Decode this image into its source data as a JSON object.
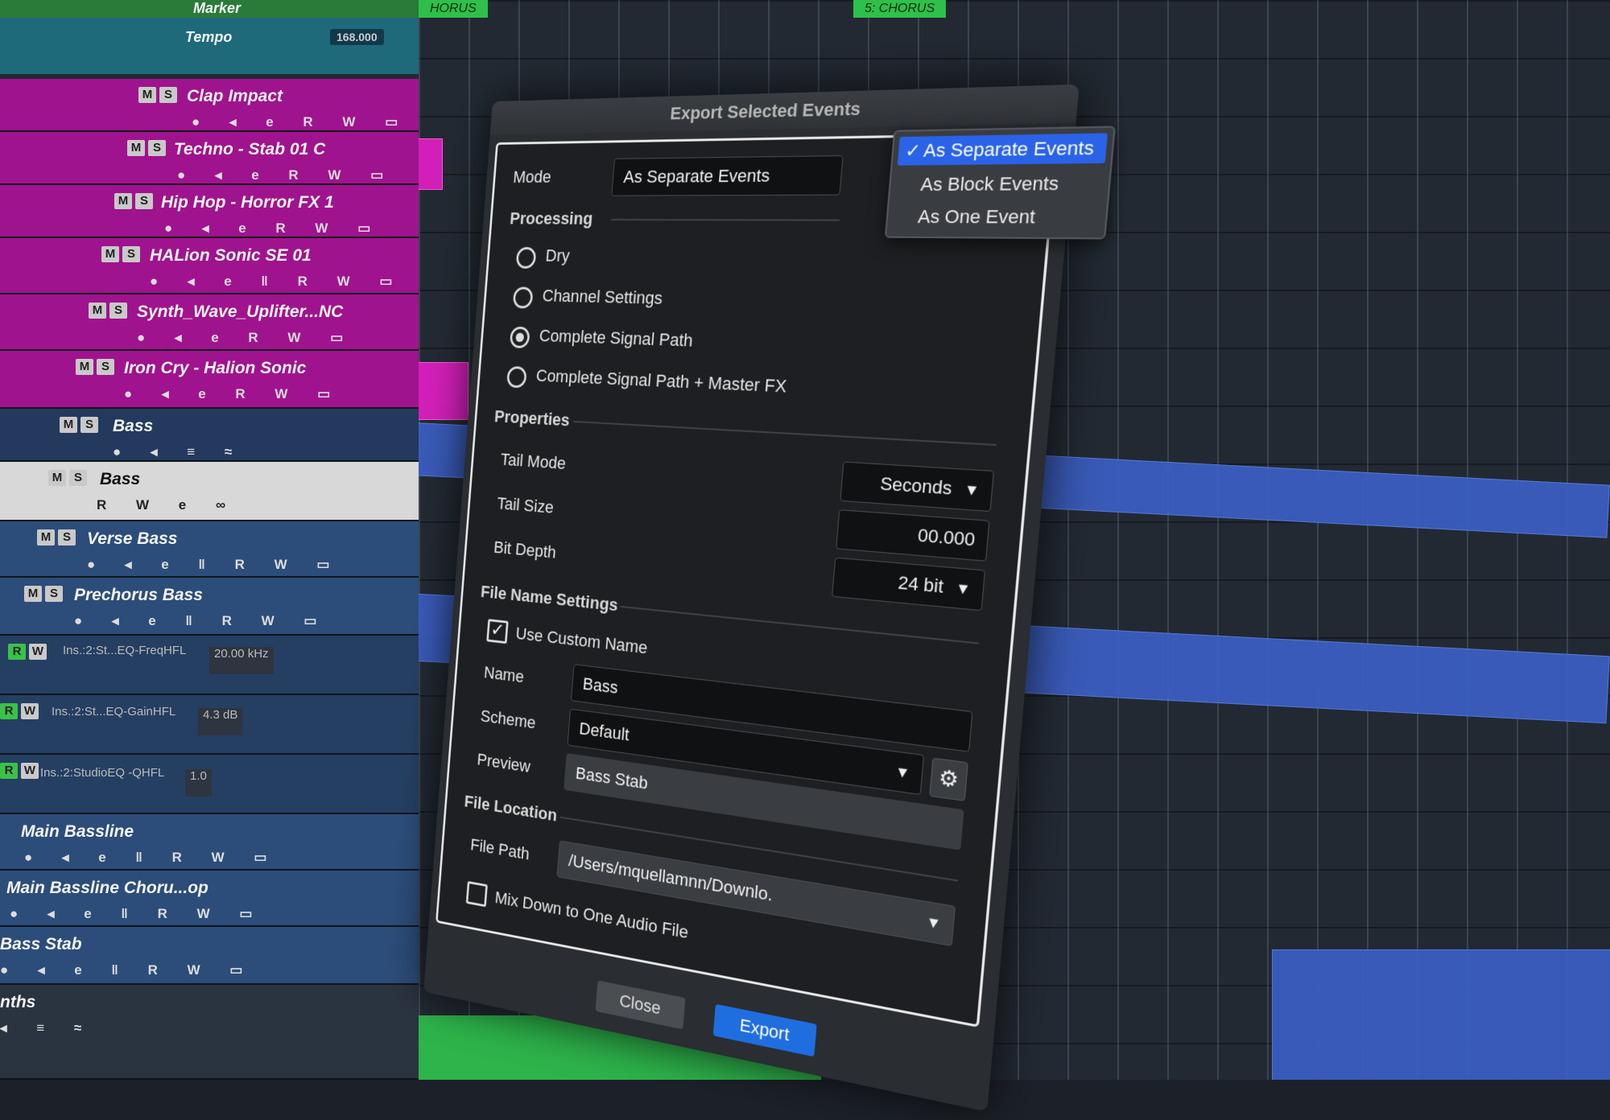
{
  "markers": {
    "marker_label": "Marker",
    "tempo_label": "Tempo",
    "tempo_value": "168.000",
    "chorus_left": "HORUS",
    "chorus_marker": "5: CHORUS"
  },
  "tracks": [
    {
      "name": "Clap Impact"
    },
    {
      "name": "Techno - Stab 01 C"
    },
    {
      "name": "Hip Hop - Horror FX 1"
    },
    {
      "name": "HALion Sonic SE 01"
    },
    {
      "name": "Synth_Wave_Uplifter...NC"
    },
    {
      "name": "Iron Cry - Halion Sonic"
    },
    {
      "name": "Bass"
    },
    {
      "name": "Bass"
    },
    {
      "name": "Verse Bass"
    },
    {
      "name": "Prechorus Bass"
    },
    {
      "name": "Main Bassline"
    },
    {
      "name": "Main Bassline Choru...op"
    },
    {
      "name": "Bass Stab"
    },
    {
      "name": "nths"
    }
  ],
  "inserts": [
    {
      "name": "Ins.:2:St...EQ-FreqHFL",
      "value": "20.00 kHz"
    },
    {
      "name": "Ins.:2:St...EQ-GainHFL",
      "value": "4.3 dB"
    },
    {
      "name": "Ins.:2:StudioEQ -QHFL",
      "value": "1.0"
    }
  ],
  "track_buttons": {
    "mute": "M",
    "solo": "S",
    "read": "R",
    "write": "W"
  },
  "dialog": {
    "title": "Export Selected Events",
    "mode_label": "Mode",
    "mode_value": "As Separate Events",
    "mode_options": [
      "As Separate Events",
      "As Block Events",
      "As One Event"
    ],
    "mode_selected_index": 0,
    "processing_header": "Processing",
    "processing_options": [
      "Dry",
      "Channel Settings",
      "Complete Signal Path",
      "Complete Signal Path + Master FX"
    ],
    "processing_selected_index": 2,
    "properties_header": "Properties",
    "tail_mode_label": "Tail Mode",
    "tail_mode_value": "Seconds",
    "tail_size_label": "Tail Size",
    "tail_size_value": "00.000",
    "bit_depth_label": "Bit Depth",
    "bit_depth_value": "24 bit",
    "file_name_header": "File Name Settings",
    "use_custom_name_label": "Use Custom Name",
    "use_custom_name_checked": true,
    "name_label": "Name",
    "name_value": "Bass",
    "scheme_label": "Scheme",
    "scheme_value": "Default",
    "preview_label": "Preview",
    "preview_value": "Bass Stab",
    "file_location_header": "File Location",
    "file_path_label": "File Path",
    "file_path_value": "/Users/mquellamnn/Downlo.",
    "mixdown_label": "Mix Down to One Audio File",
    "mixdown_checked": false,
    "close_label": "Close",
    "export_label": "Export"
  },
  "colors": {
    "accent_blue": "#2a63e8",
    "export_button": "#1f6ee0",
    "track_magenta": "#a0138e",
    "clip_magenta": "#d21fb8",
    "clip_blue": "#3b5fc4",
    "marker_green": "#2ec04a"
  }
}
